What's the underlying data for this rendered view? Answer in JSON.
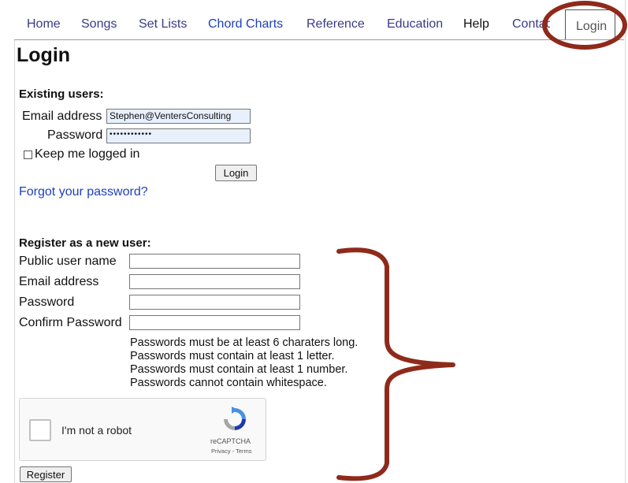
{
  "nav": {
    "items": [
      "Home",
      "Songs",
      "Set Lists",
      "Chord Charts",
      "Reference",
      "Education",
      "Help",
      "Contact"
    ],
    "active_tab": "Login"
  },
  "page": {
    "title": "Login"
  },
  "existing": {
    "heading": "Existing users:",
    "email_label": "Email address",
    "email_value": "Stephen@VentersConsulting",
    "password_label": "Password",
    "password_value": "••••••••••••",
    "keep_label": "Keep me logged in",
    "login_button": "Login",
    "forgot_link": "Forgot your password?"
  },
  "register": {
    "heading": "Register as a new user:",
    "username_label": "Public user name",
    "email_label": "Email address",
    "password_label": "Password",
    "confirm_label": "Confirm Password",
    "rules": [
      "Passwords must be at least 6 charaters long.",
      "Passwords must contain at least 1 letter.",
      "Passwords must contain at least 1 number.",
      "Passwords cannot contain whitespace."
    ],
    "register_button": "Register"
  },
  "captcha": {
    "label": "I'm not a robot",
    "brand": "reCAPTCHA",
    "links": "Privacy - Terms"
  },
  "annotation_color": "#8f2a1b"
}
